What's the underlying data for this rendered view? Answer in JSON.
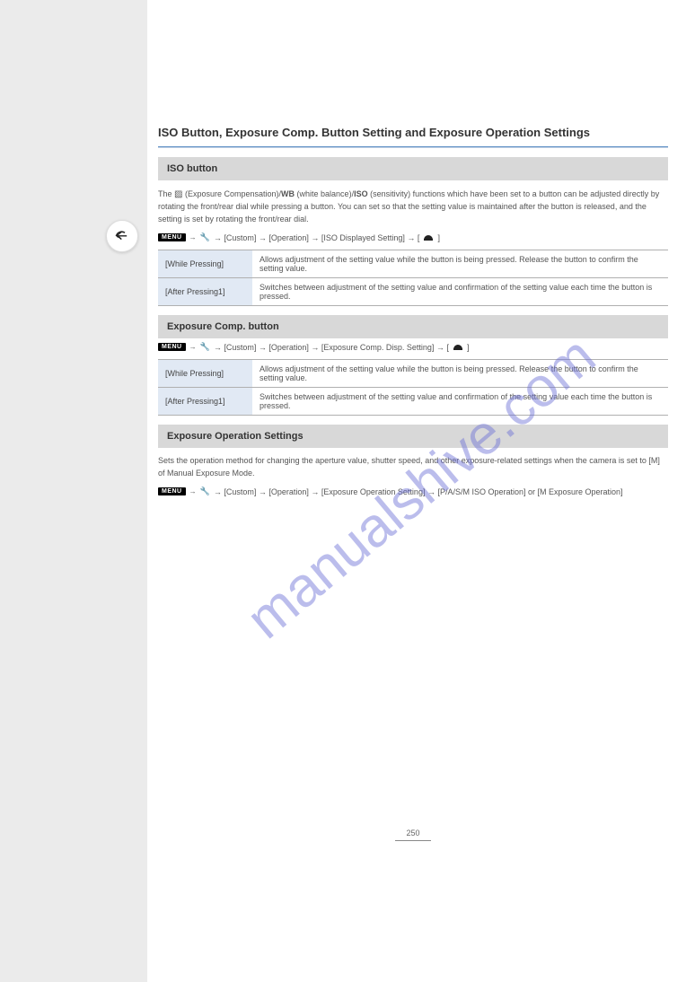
{
  "title": "ISO Button, Exposure Comp. Button Setting and Exposure Operation Settings",
  "sections": {
    "iso": {
      "heading": "ISO button",
      "description_parts": {
        "pre": "The ",
        "icon": "☄",
        "mid_ev": " (Exposure Compensation)/",
        "wb": "WB",
        "mid_wb": " (white balance)/",
        "iso_lbl": "ISO",
        "after": " (sensitivity) functions which have been set to a button can be adjusted directly by rotating the front/rear dial while pressing a button. You can set so that the setting value is maintained after the button is released, and the setting is set by rotating the front/rear dial."
      },
      "crumb": {
        "menu": "MENU",
        "a1": "→",
        "gear": "⚒",
        "a2": "→ [Custom] → [Operation] → [ISO Displayed Setting] → [",
        "dial": "⌒",
        "close": "]"
      },
      "rows": [
        {
          "label": "[While Pressing]",
          "desc": "Allows adjustment of the setting value while the button is being pressed. Release the button to confirm the setting value."
        },
        {
          "label": "[After Pressing1]",
          "desc": "Switches between adjustment of the setting value and confirmation of the setting value each time the button is pressed."
        }
      ]
    },
    "expcomp": {
      "heading": "Exposure Comp. button",
      "crumb": {
        "menu": "MENU",
        "a1": "→",
        "gear": "⚒",
        "a2": "→ [Custom] → [Operation] → [Exposure Comp. Disp. Setting] → [",
        "dial": "⌒",
        "close": "]"
      },
      "rows": [
        {
          "label": "[While Pressing]",
          "desc": "Allows adjustment of the setting value while the button is being pressed. Release the button to confirm the setting value."
        },
        {
          "label": "[After Pressing1]",
          "desc": "Switches between adjustment of the setting value and confirmation of the setting value each time the button is pressed."
        }
      ]
    },
    "expops": {
      "heading": "Exposure Operation Settings",
      "description": "Sets the operation method for changing the aperture value, shutter speed, and other exposure-related settings when the camera is set to [M] of Manual Exposure Mode.",
      "crumb": {
        "menu": "MENU",
        "a1": "→",
        "gear": "⚒",
        "a2": "→ [Custom] → [Operation] → [Exposure Operation Setting] → [P/A/S/M ISO Operation] or [M Exposure Operation]"
      }
    }
  },
  "page_number": "250",
  "watermark": "manualshive.com"
}
